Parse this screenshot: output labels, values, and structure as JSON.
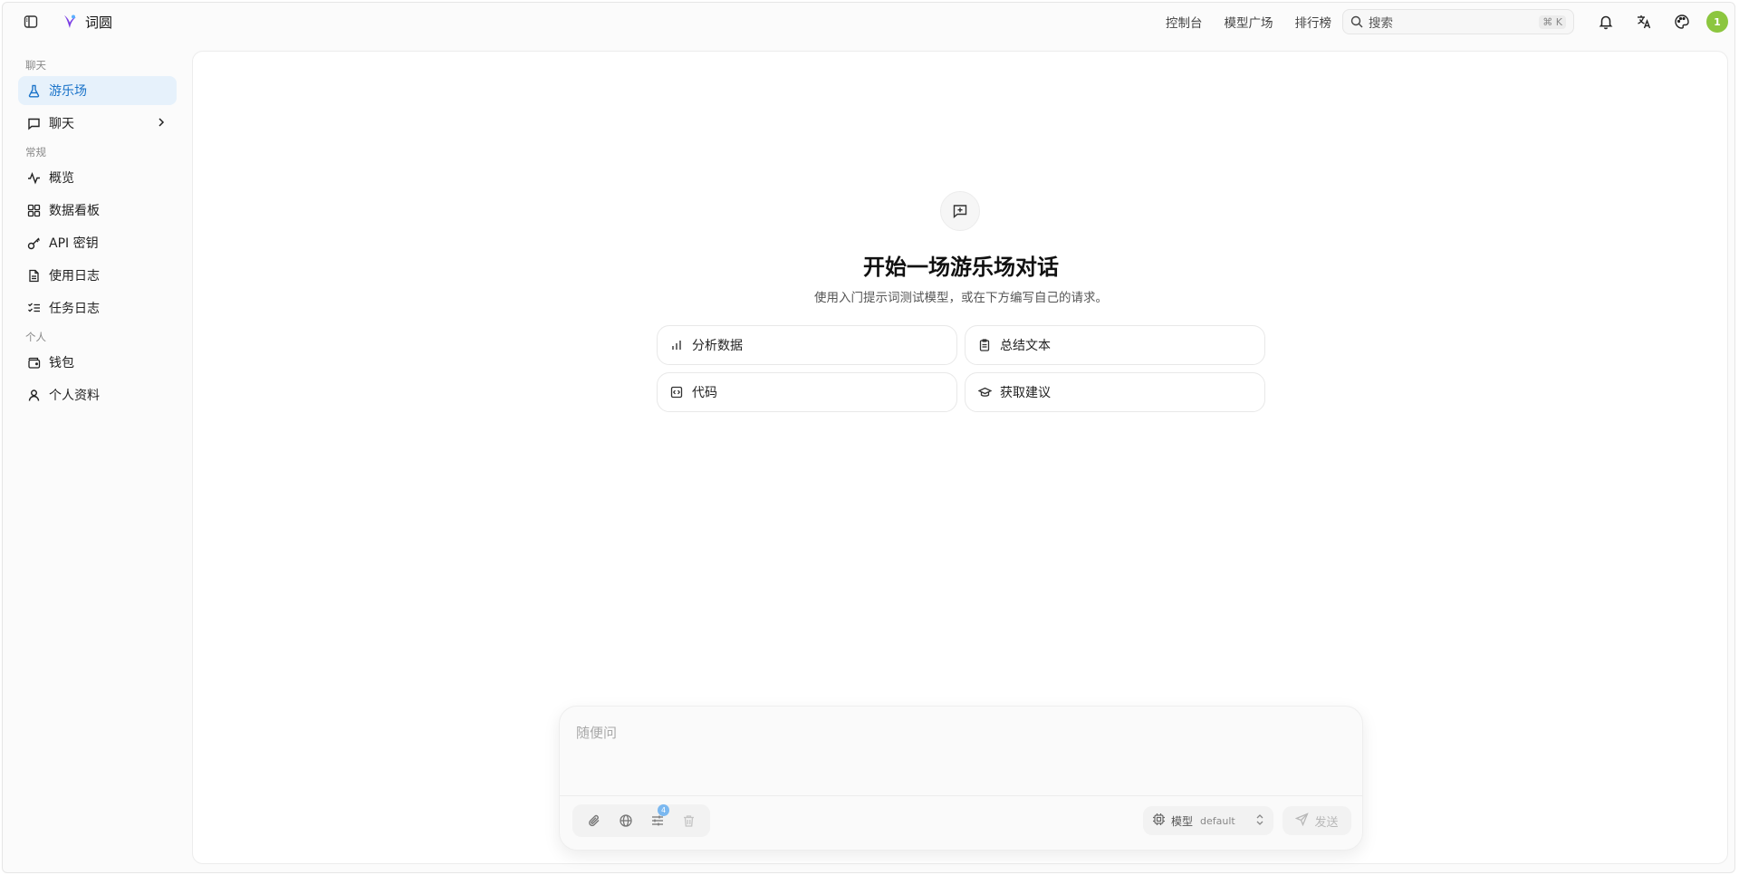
{
  "app": {
    "name": "词圆"
  },
  "topnav": {
    "links": [
      "控制台",
      "模型广场",
      "排行榜"
    ],
    "search_placeholder": "搜索",
    "search_shortcut": "⌘ K",
    "avatar_label": "1",
    "avatar_color": "#8cc63f"
  },
  "sidebar": {
    "sections": [
      {
        "label": "聊天",
        "items": [
          {
            "label": "游乐场",
            "icon": "flask-icon",
            "active": true
          },
          {
            "label": "聊天",
            "icon": "message-square-icon",
            "has_chevron": true
          }
        ]
      },
      {
        "label": "常规",
        "items": [
          {
            "label": "概览",
            "icon": "activity-icon"
          },
          {
            "label": "数据看板",
            "icon": "grid-icon"
          },
          {
            "label": "API 密钥",
            "icon": "key-icon"
          },
          {
            "label": "使用日志",
            "icon": "file-text-icon"
          },
          {
            "label": "任务日志",
            "icon": "list-checks-icon"
          }
        ]
      },
      {
        "label": "个人",
        "items": [
          {
            "label": "钱包",
            "icon": "wallet-icon"
          },
          {
            "label": "个人资料",
            "icon": "user-icon"
          }
        ]
      }
    ]
  },
  "hero": {
    "title": "开始一场游乐场对话",
    "subtitle": "使用入门提示词测试模型，或在下方编写自己的请求。"
  },
  "suggestions": [
    {
      "label": "分析数据",
      "icon": "bar-chart-icon"
    },
    {
      "label": "总结文本",
      "icon": "clipboard-icon"
    },
    {
      "label": "代码",
      "icon": "code-icon"
    },
    {
      "label": "获取建议",
      "icon": "graduation-cap-icon"
    }
  ],
  "composer": {
    "placeholder": "随便问",
    "params_badge": "4",
    "model_label": "模型",
    "model_value": "default",
    "send_label": "发送"
  },
  "colors": {
    "accent": "#1a73c9",
    "active_bg": "#e6f1fb"
  }
}
